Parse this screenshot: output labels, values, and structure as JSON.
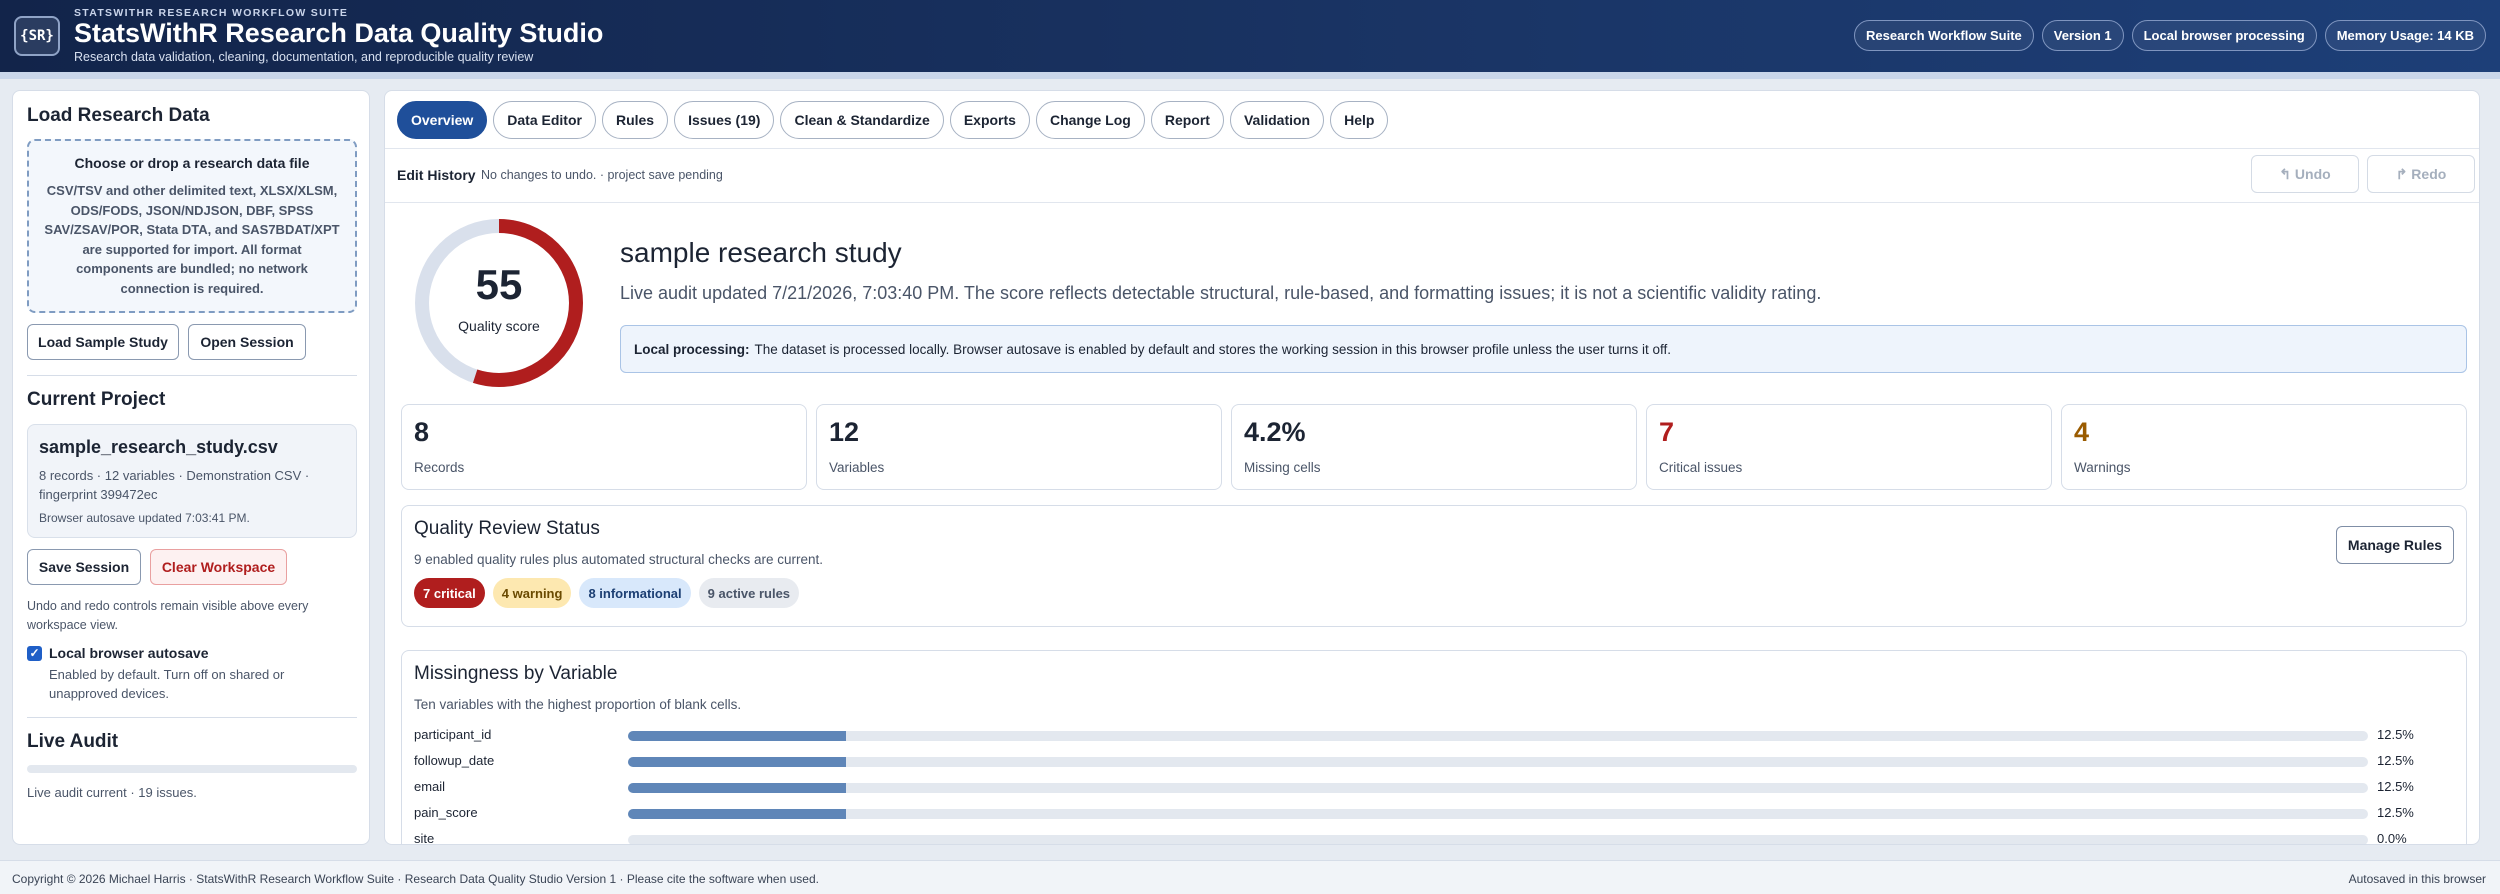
{
  "header": {
    "suite_label": "STATSWITHR RESEARCH WORKFLOW SUITE",
    "logo_text": "{SR}",
    "title": "StatsWithR Research Data Quality Studio",
    "subtitle": "Research data validation, cleaning, documentation, and reproducible quality review",
    "badges": [
      "Research Workflow Suite",
      "Version 1",
      "Local browser processing",
      "Memory Usage: 14 KB"
    ]
  },
  "sidebar": {
    "load_heading": "Load Research Data",
    "dropzone_title": "Choose or drop a research data file",
    "dropzone_text": "CSV/TSV and other delimited text, XLSX/XLSM, ODS/FODS, JSON/NDJSON, DBF, SPSS SAV/ZSAV/POR, Stata DTA, and SAS7BDAT/XPT are supported for import. All format components are bundled; no network connection is required.",
    "load_sample_label": "Load Sample Study",
    "open_session_label": "Open Session",
    "project_heading": "Current Project",
    "project_name": "sample_research_study.csv",
    "project_meta": "8 records · 12 variables · Demonstration CSV · fingerprint 399472ec",
    "project_autosave": "Browser autosave updated 7:03:41 PM.",
    "save_session_label": "Save Session",
    "clear_workspace_label": "Clear Workspace",
    "undo_note": "Undo and redo controls remain visible above every workspace view.",
    "autosave_label": "Local browser autosave",
    "autosave_text": "Enabled by default. Turn off on shared or unapproved devices.",
    "autosave_checked": true,
    "audit_heading": "Live Audit",
    "audit_status": "Live audit current · 19 issues."
  },
  "tabs": [
    {
      "label": "Overview",
      "active": true
    },
    {
      "label": "Data Editor",
      "active": false
    },
    {
      "label": "Rules",
      "active": false
    },
    {
      "label": "Issues (19)",
      "active": false
    },
    {
      "label": "Clean & Standardize",
      "active": false
    },
    {
      "label": "Exports",
      "active": false
    },
    {
      "label": "Change Log",
      "active": false
    },
    {
      "label": "Report",
      "active": false
    },
    {
      "label": "Validation",
      "active": false
    },
    {
      "label": "Help",
      "active": false
    }
  ],
  "edit_history": {
    "label": "Edit History",
    "status": "No changes to undo. · project save pending",
    "undo_label": "↰ Undo",
    "redo_label": "↱ Redo"
  },
  "overview": {
    "score": "55",
    "score_fraction": 0.55,
    "score_label": "Quality score",
    "study_title": "sample research study",
    "audit_text": "Live audit updated 7/21/2026, 7:03:40 PM. The score reflects detectable structural, rule-based, and formatting issues; it is not a scientific validity rating.",
    "local_label": "Local processing:",
    "local_text": "The dataset is processed locally. Browser autosave is enabled by default and stores the working session in this browser profile unless the user turns it off."
  },
  "stats": [
    {
      "value": "8",
      "label": "Records",
      "color": "#1c2433"
    },
    {
      "value": "12",
      "label": "Variables",
      "color": "#1c2433"
    },
    {
      "value": "4.2%",
      "label": "Missing cells",
      "color": "#1c2433"
    },
    {
      "value": "7",
      "label": "Critical issues",
      "color": "#b01e1e"
    },
    {
      "value": "4",
      "label": "Warnings",
      "color": "#9a5b00"
    }
  ],
  "quality_status": {
    "title": "Quality Review Status",
    "subtitle": "9 enabled quality rules plus automated structural checks are current.",
    "manage_label": "Manage Rules",
    "pills": [
      {
        "label": "7 critical",
        "bg": "#b01e1e",
        "fg": "#ffffff"
      },
      {
        "label": "4 warning",
        "bg": "#fde8b0",
        "fg": "#6a4a00"
      },
      {
        "label": "8 informational",
        "bg": "#d8e8fb",
        "fg": "#1c3f73"
      },
      {
        "label": "9 active rules",
        "bg": "#e8ebf0",
        "fg": "#4a5568"
      }
    ]
  },
  "missingness": {
    "title": "Missingness by Variable",
    "subtitle": "Ten variables with the highest proportion of blank cells.",
    "rows": [
      {
        "name": "participant_id",
        "pct_label": "12.5%",
        "value": 12.5
      },
      {
        "name": "followup_date",
        "pct_label": "12.5%",
        "value": 12.5
      },
      {
        "name": "email",
        "pct_label": "12.5%",
        "value": 12.5
      },
      {
        "name": "pain_score",
        "pct_label": "12.5%",
        "value": 12.5
      },
      {
        "name": "site",
        "pct_label": "0.0%",
        "value": 0.0
      }
    ]
  },
  "footer": {
    "left": "Copyright © 2026 Michael Harris · StatsWithR Research Workflow Suite · Research Data Quality Studio Version 1 · Please cite the software when used.",
    "right": "Autosaved in this browser"
  },
  "colors": {
    "accent": "#1f4f9a",
    "gauge_fill": "#b01e1e",
    "gauge_track": "#d9e0ec",
    "bar_fill": "#5f86b8"
  }
}
